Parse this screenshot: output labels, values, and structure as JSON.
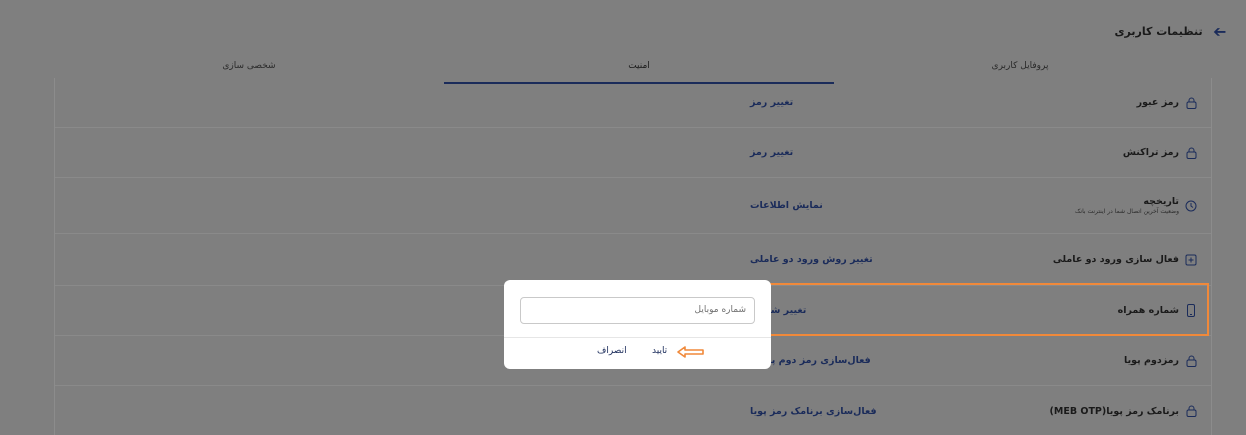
{
  "header": {
    "title": "تنظیمات کاربری",
    "back_icon": "arrow-left-icon"
  },
  "tabs": [
    {
      "label": "پروفایل کاربری",
      "active": false
    },
    {
      "label": "امنیت",
      "active": true
    },
    {
      "label": "شخصی سازی",
      "active": false
    }
  ],
  "rows": [
    {
      "label": "رمز عبور",
      "icon": "lock-icon",
      "action": "تغییر رمز"
    },
    {
      "label": "رمز تراکنش",
      "icon": "lock-icon",
      "action": "تغییر رمز"
    },
    {
      "label": "تاریخچه",
      "sublabel": "وضعیت آخرین اتصال شما در اینترنت بانک",
      "icon": "history-icon",
      "action": "نمایش اطلاعات"
    },
    {
      "label": "فعال سازی ورود دو عاملی",
      "icon": "plus-box-icon",
      "action": "تغییر روش ورود دو عاملی"
    },
    {
      "label": "شماره همراه",
      "icon": "mobile-icon",
      "action": "تغییر شماره"
    },
    {
      "label": "رمزدوم پویا",
      "icon": "lock-icon",
      "action": "فعال‌سازی رمز دوم پویای"
    },
    {
      "label": "برنامک رمز پویا(MEB OTP)",
      "icon": "lock-icon",
      "action": "فعال‌سازی برنامک رمز پویا"
    }
  ],
  "modal": {
    "input_placeholder": "شماره موبایل",
    "confirm_label": "تایید",
    "cancel_label": "انصراف"
  },
  "colors": {
    "accent": "#1a2b5a",
    "highlight": "#f0893a",
    "overlay": "#7f7f7f"
  }
}
